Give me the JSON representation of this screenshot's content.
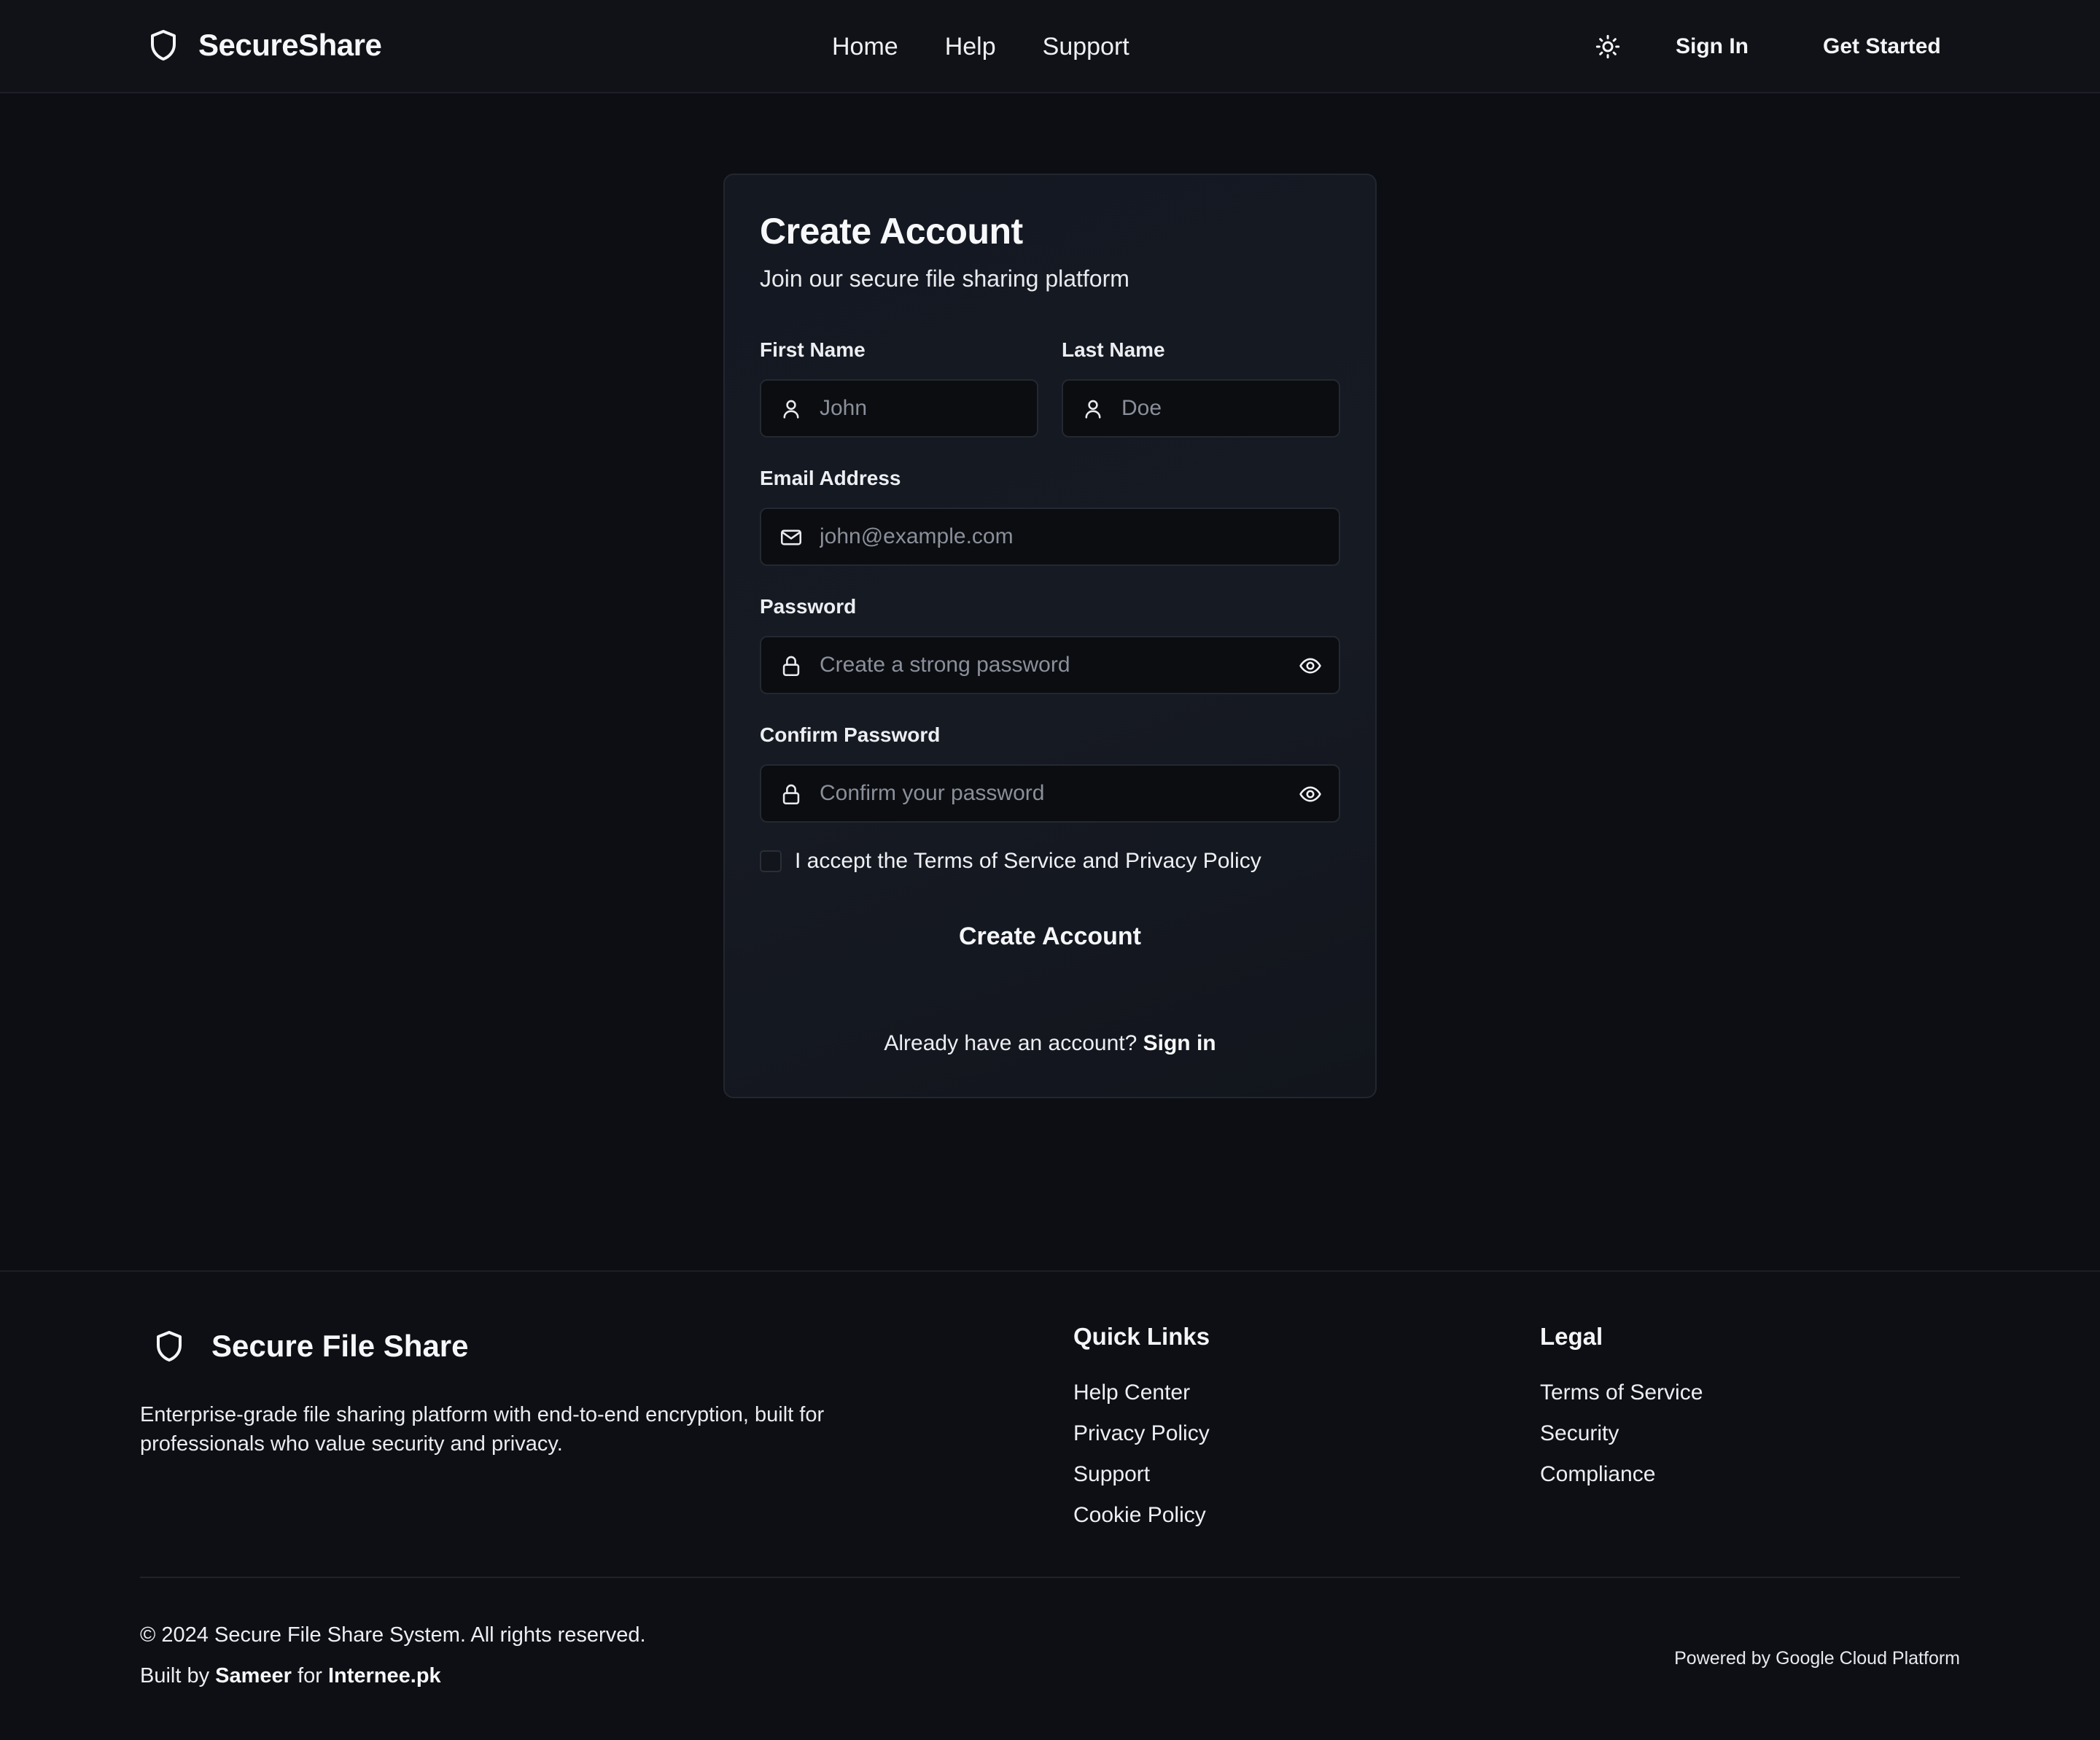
{
  "header": {
    "brand": "SecureShare",
    "nav": [
      "Home",
      "Help",
      "Support"
    ],
    "theme_icon": "sun-icon",
    "sign_in": "Sign In",
    "get_started": "Get Started"
  },
  "form": {
    "title": "Create Account",
    "subtitle": "Join our secure file sharing platform",
    "first_name": {
      "label": "First Name",
      "placeholder": "John",
      "icon": "user-icon"
    },
    "last_name": {
      "label": "Last Name",
      "placeholder": "Doe",
      "icon": "user-icon"
    },
    "email": {
      "label": "Email Address",
      "placeholder": "john@example.com",
      "icon": "mail-icon"
    },
    "password": {
      "label": "Password",
      "placeholder": "Create a strong password",
      "icon": "lock-icon"
    },
    "confirm_password": {
      "label": "Confirm Password",
      "placeholder": "Confirm your password",
      "icon": "lock-icon"
    },
    "terms_text": "I accept the Terms of Service and Privacy Policy",
    "terms_checked": false,
    "submit": "Create Account",
    "already_text": "Already have an account?",
    "sign_in_link": "Sign in"
  },
  "footer": {
    "brand": "Secure File Share",
    "description": "Enterprise-grade file sharing platform with end-to-end encryption, built for professionals who value security and privacy.",
    "quick_links": {
      "title": "Quick Links",
      "items": [
        "Help Center",
        "Privacy Policy",
        "Support",
        "Cookie Policy"
      ]
    },
    "legal": {
      "title": "Legal",
      "items": [
        "Terms of Service",
        "Security",
        "Compliance"
      ]
    },
    "copyright": "© 2024 Secure File Share System. All rights reserved.",
    "built_prefix": "Built by",
    "built_author": "Sameer",
    "built_middle": "for",
    "built_org": "Internee.pk",
    "powered": "Powered by Google Cloud Platform"
  },
  "colors": {
    "background": "#0c0e13",
    "card": "#151922",
    "input": "#0b0d11",
    "text": "#f4f5f7",
    "placeholder": "#8a8f9a"
  }
}
